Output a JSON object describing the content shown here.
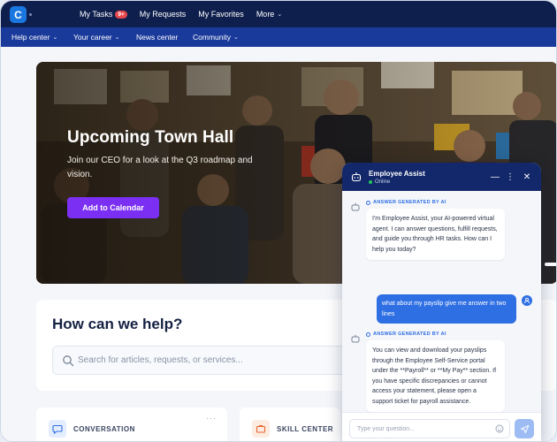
{
  "topbar": {
    "logo_letter": "C",
    "nav": [
      {
        "label": "My Tasks",
        "badge": "9+"
      },
      {
        "label": "My Requests"
      },
      {
        "label": "My Favorites"
      },
      {
        "label": "More"
      }
    ]
  },
  "subnav": {
    "items": [
      {
        "label": "Help center"
      },
      {
        "label": "Your career"
      },
      {
        "label": "News center"
      },
      {
        "label": "Community"
      }
    ]
  },
  "hero": {
    "title": "Upcoming Town Hall",
    "subtitle": "Join our CEO for a look at the Q3 roadmap and vision.",
    "button_label": "Add to Calendar"
  },
  "help": {
    "title": "How can we help?",
    "search_placeholder": "Search for articles, requests, or services..."
  },
  "cards": [
    {
      "label": "CONVERSATION",
      "icon": "chat-bubble-icon"
    },
    {
      "label": "SKILL CENTER",
      "icon": "briefcase-icon"
    }
  ],
  "chat": {
    "name": "Employee Assist",
    "status": "Online",
    "ai_tag": "ANSWER GENERATED BY AI",
    "messages": [
      {
        "from": "ai",
        "text": "I'm Employee Assist, your AI-powered virtual agent. I can answer questions, fulfill requests, and guide you through HR tasks. How can I help you today?"
      },
      {
        "from": "user",
        "text": "what about my payslip give me answer in two lines"
      },
      {
        "from": "ai",
        "text": "You can view and download your payslips through the Employee Self-Service portal under the **Payroll** or **My Pay** section. If you have specific discrepancies or cannot access your statement, please open a support ticket for payroll assistance."
      }
    ],
    "input_placeholder": "Type your question..."
  },
  "colors": {
    "topbar": "#0e1f4d",
    "subnav": "#1a3a9b",
    "accent_purple": "#7b2ff2",
    "accent_blue": "#2f6fe4"
  }
}
